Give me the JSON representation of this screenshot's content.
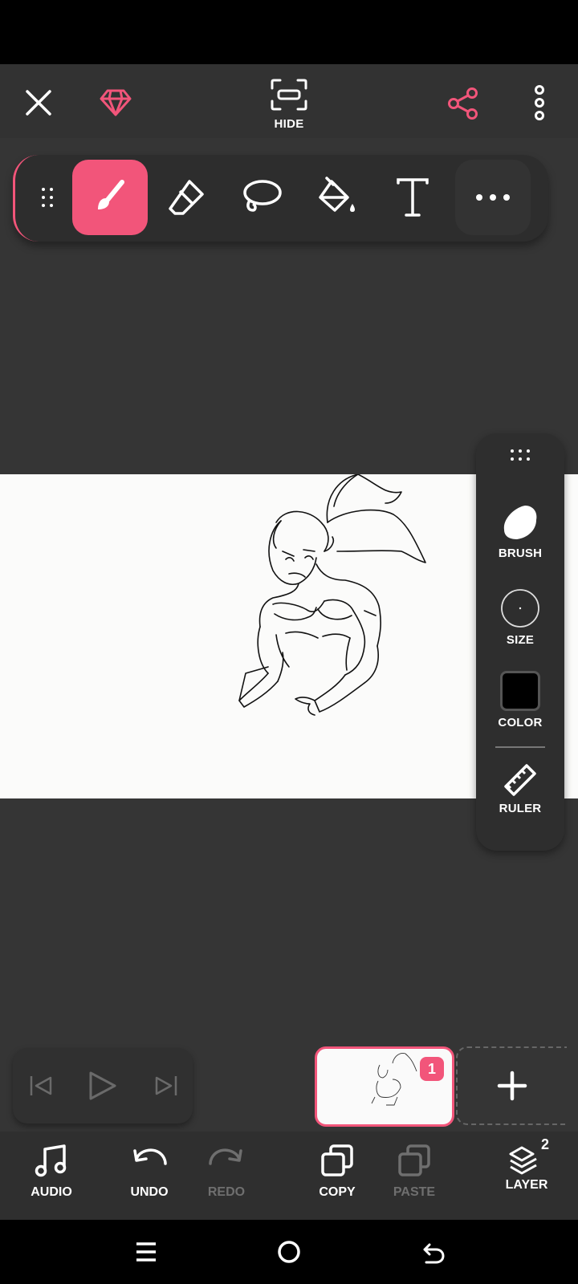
{
  "top_bar": {
    "hide_label": "HIDE"
  },
  "icons": {
    "close": "close-icon",
    "premium": "diamond-icon",
    "hide": "fullscreen-icon",
    "share": "share-icon",
    "more": "more-vertical-icon"
  },
  "toolbar": {
    "tools": [
      "drag-handle",
      "brush",
      "eraser",
      "lasso",
      "fill",
      "text",
      "more"
    ],
    "active_tool": "brush"
  },
  "side_panel": {
    "brush_label": "BRUSH",
    "size_label": "SIZE",
    "color_label": "COLOR",
    "ruler_label": "RULER",
    "current_color": "#000000"
  },
  "frames": {
    "current_frame_number": "1"
  },
  "bottom_bar": {
    "audio_label": "AUDIO",
    "undo_label": "UNDO",
    "redo_label": "REDO",
    "copy_label": "COPY",
    "paste_label": "PASTE",
    "layer_label": "LAYER",
    "layer_count": "2"
  },
  "colors": {
    "accent": "#f2557a",
    "background": "#353535",
    "panel": "#2e2e2e",
    "canvas": "#fbfbfa"
  }
}
